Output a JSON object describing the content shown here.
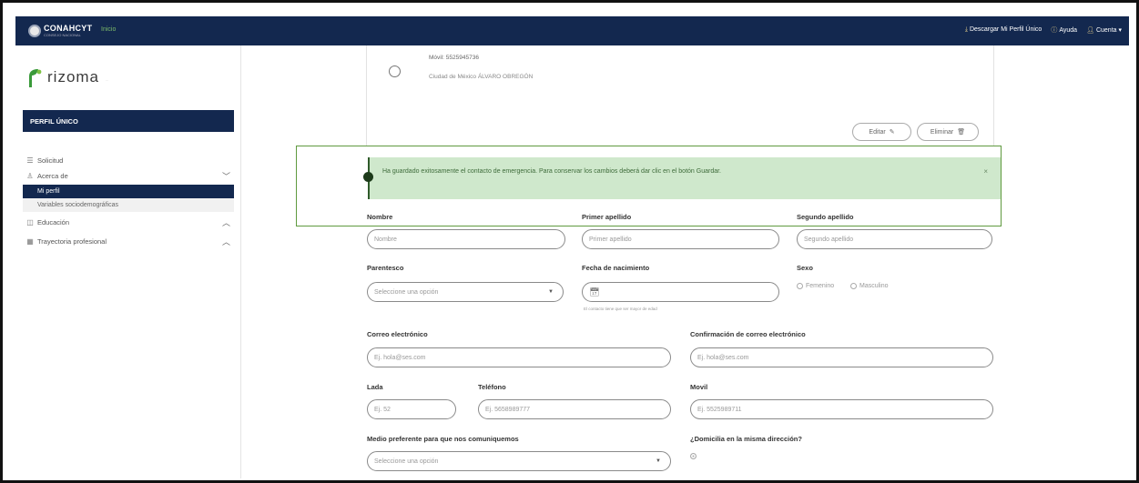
{
  "topbar": {
    "logo_text": "CONAHCYT",
    "logo_sub": "CONSEJO NACIONAL",
    "nav_inicio": "Inicio",
    "descargar": "Descargar Mi Perfil Único",
    "ayuda": "Ayuda",
    "cuenta": "Cuenta"
  },
  "sidebar": {
    "brand": "rizoma",
    "brand_tag": "...",
    "section": "PERFIL ÚNICO",
    "items": [
      {
        "label": "Solicitud"
      },
      {
        "label": "Acerca de"
      },
      {
        "label": "Mi perfil"
      },
      {
        "label": "Variables sociodemográficas"
      },
      {
        "label": "Educación"
      },
      {
        "label": "Trayectoria profesional"
      }
    ]
  },
  "card": {
    "line1": "Móvil: 5525945736",
    "line2": "Ciudad de México ÁLVARO OBREGÓN",
    "edit_label": "Editar",
    "delete_label": "Eliminar"
  },
  "alert": {
    "message": "Ha guardado exitosamente el contacto de emergencia. Para conservar los cambios deberá dar clic en el botón Guardar.",
    "close": "×"
  },
  "form": {
    "nombre": {
      "label": "Nombre",
      "placeholder": "Nombre"
    },
    "primer_apellido": {
      "label": "Primer apellido",
      "placeholder": "Primer apellido"
    },
    "segundo_apellido": {
      "label": "Segundo apellido",
      "placeholder": "Segundo apellido"
    },
    "parentesco": {
      "label": "Parentesco",
      "placeholder": "Seleccione una opción"
    },
    "fecha": {
      "label": "Fecha de nacimiento",
      "hint": "El contacto tiene que ser mayor de edad"
    },
    "sexo": {
      "label": "Sexo",
      "opt1": "Femenino",
      "opt2": "Masculino"
    },
    "correo": {
      "label": "Correo electrónico",
      "placeholder": "Ej. hola@ses.com"
    },
    "confirmacion": {
      "label": "Confirmación de correo electrónico",
      "placeholder": "Ej. hola@ses.com"
    },
    "lada": {
      "label": "Lada",
      "placeholder": "Ej. 52"
    },
    "telefono": {
      "label": "Teléfono",
      "placeholder": "Ej. 5658989777"
    },
    "movil": {
      "label": "Movil",
      "placeholder": "Ej. 5525989711"
    },
    "medio": {
      "label": "Medio preferente para que nos comuniquemos",
      "placeholder": "Seleccione una opción"
    },
    "domicilia": {
      "label": "¿Domicilia en la misma dirección?"
    }
  },
  "colors": {
    "navy": "#13284f",
    "alert_bg": "#cfe8cc",
    "alert_border": "#5f9a3f"
  }
}
